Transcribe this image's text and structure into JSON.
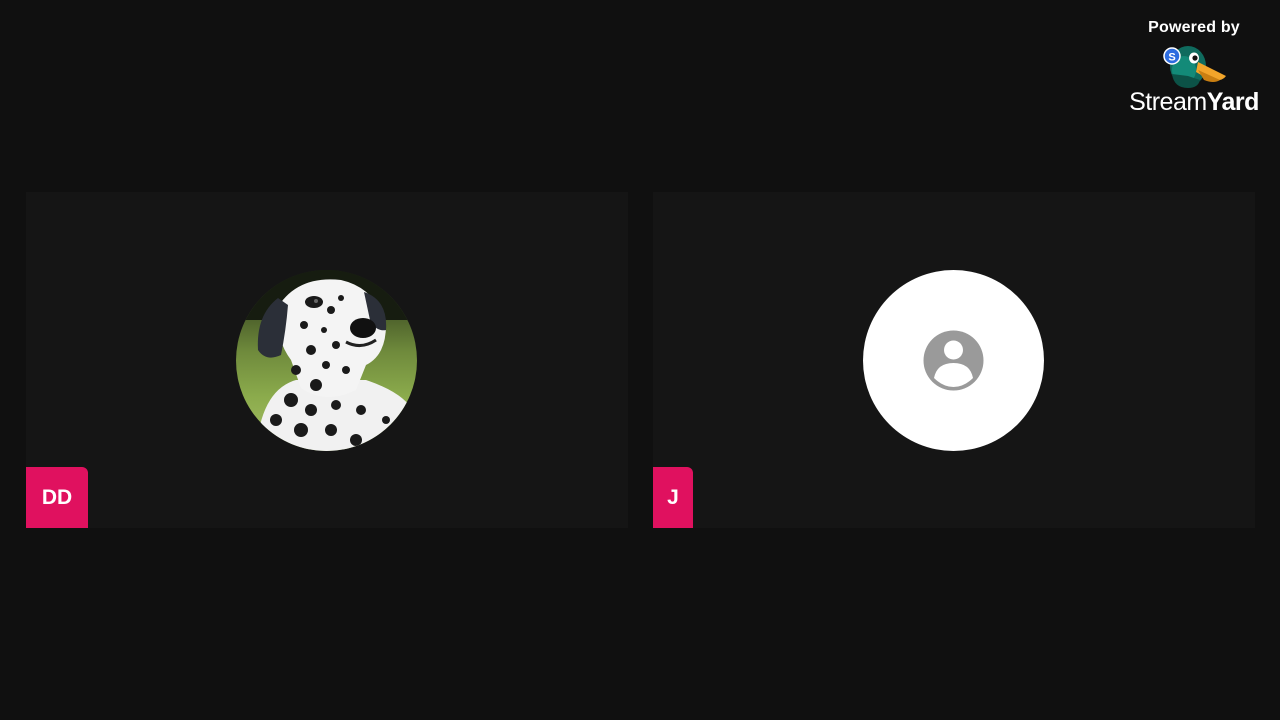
{
  "branding": {
    "powered_by": "Powered by",
    "brand_part1": "Stream",
    "brand_part2": "Yard",
    "logo_icon": "streamyard-duck-icon"
  },
  "participants": [
    {
      "initials": "DD",
      "avatar": "dalmatian-photo",
      "tag_color": "#e0115f"
    },
    {
      "initials": "J",
      "avatar": "default-person-icon",
      "tag_color": "#e0115f"
    }
  ],
  "colors": {
    "background": "#101010",
    "tile_background": "#151515",
    "accent": "#e0115f",
    "default_avatar_icon": "#9a9a9a"
  }
}
